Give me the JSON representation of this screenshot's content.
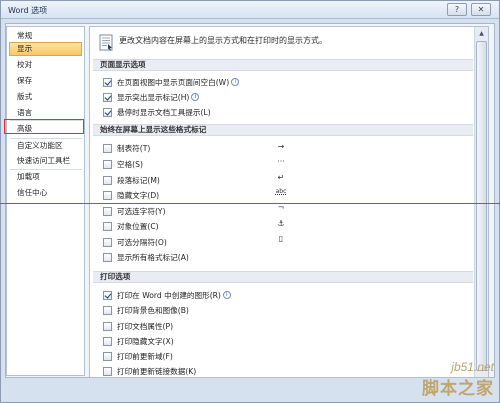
{
  "window": {
    "title": "Word 选项"
  },
  "sidebar": {
    "items": [
      {
        "label": "常规"
      },
      {
        "label": "显示"
      },
      {
        "label": "校对"
      },
      {
        "label": "保存"
      },
      {
        "label": "版式"
      },
      {
        "label": "语言"
      },
      {
        "label": "高级"
      },
      {
        "label": "自定义功能区"
      },
      {
        "label": "快速访问工具栏"
      },
      {
        "label": "加载项"
      },
      {
        "label": "信任中心"
      }
    ],
    "selected": "显示"
  },
  "main": {
    "header_text": "更改文档内容在屏幕上的显示方式和在打印时的显示方式。",
    "page_display": {
      "title": "页面显示选项",
      "options": [
        {
          "label": "在页面视图中显示页面间空白(W)",
          "checked": true,
          "info": true
        },
        {
          "label": "显示突出显示标记(H)",
          "checked": true,
          "info": true
        },
        {
          "label": "悬停时显示文档工具提示(L)",
          "checked": true,
          "info": false
        }
      ]
    },
    "formatting_marks": {
      "title": "始终在屏幕上显示这些格式标记",
      "options": [
        {
          "label": "制表符(T)",
          "checked": false,
          "symbol": "→"
        },
        {
          "label": "空格(S)",
          "checked": false,
          "symbol": "···"
        },
        {
          "label": "段落标记(M)",
          "checked": false,
          "symbol": "↵"
        },
        {
          "label": "隐藏文字(D)",
          "checked": false,
          "symbol": "abc"
        },
        {
          "label": "可选连字符(Y)",
          "checked": false,
          "symbol": "¬"
        },
        {
          "label": "对象位置(C)",
          "checked": false,
          "symbol": "⚓"
        },
        {
          "label": "可选分隔符(O)",
          "checked": false,
          "symbol": "▯"
        },
        {
          "label": "显示所有格式标记(A)",
          "checked": false,
          "symbol": ""
        }
      ]
    },
    "print": {
      "title": "打印选项",
      "options": [
        {
          "label": "打印在 Word 中创建的图形(R)",
          "checked": true,
          "info": true
        },
        {
          "label": "打印背景色和图像(B)",
          "checked": false,
          "info": false
        },
        {
          "label": "打印文档属性(P)",
          "checked": false,
          "info": false
        },
        {
          "label": "打印隐藏文字(X)",
          "checked": false,
          "info": false
        },
        {
          "label": "打印前更新域(F)",
          "checked": false,
          "info": false
        },
        {
          "label": "打印前更新链接数据(K)",
          "checked": false,
          "info": false
        }
      ]
    }
  },
  "watermark": {
    "site": "jb51.net",
    "name": "脚本之家"
  },
  "colors": {
    "highlight_red": "#e03036",
    "selected_bg": "#f7c864"
  }
}
